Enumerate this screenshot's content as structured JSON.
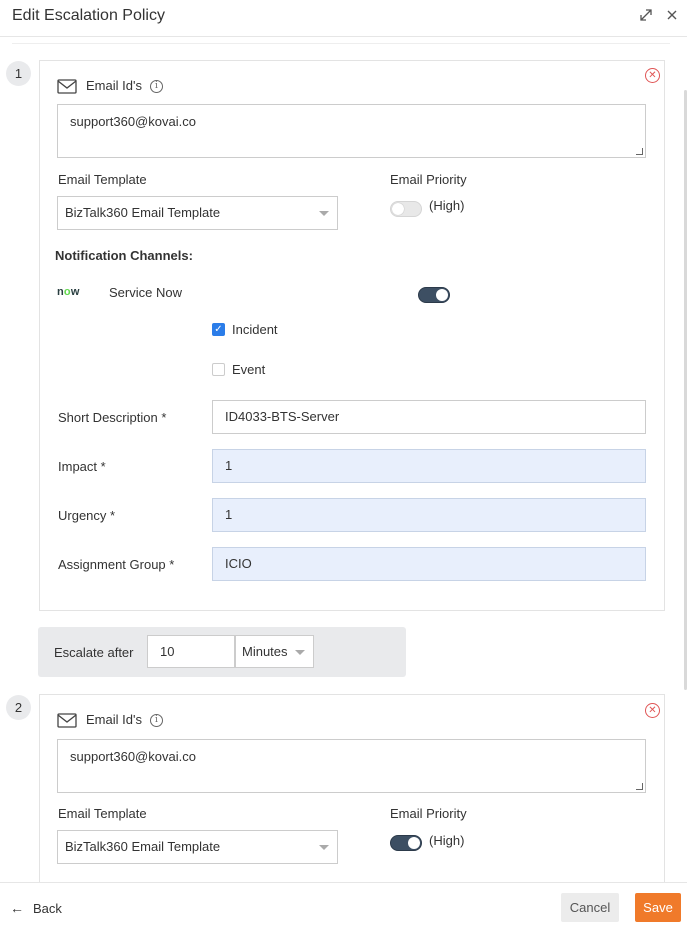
{
  "header": {
    "title": "Edit Escalation Policy",
    "expand_icon": "expand-icon",
    "close_icon": "close-icon"
  },
  "steps": [
    {
      "number": "1",
      "email_label": "Email Id's",
      "email_value": "support360@kovai.co",
      "template_label": "Email Template",
      "template_value": "BizTalk360 Email Template",
      "priority_label": "Email Priority",
      "priority_text": "(High)",
      "priority_on": false,
      "notification_label": "Notification Channels:",
      "channel": {
        "logo": "now",
        "name": "Service Now",
        "enabled": true,
        "incident_label": "Incident",
        "incident_checked": true,
        "event_label": "Event",
        "event_checked": false
      },
      "fields": {
        "short_description_label": "Short Description *",
        "short_description_value": "ID4033-BTS-Server",
        "impact_label": "Impact *",
        "impact_value": "1",
        "urgency_label": "Urgency *",
        "urgency_value": "1",
        "assignment_group_label": "Assignment Group *",
        "assignment_group_value": "ICIO"
      }
    },
    {
      "number": "2",
      "email_label": "Email Id's",
      "email_value": "support360@kovai.co",
      "template_label": "Email Template",
      "template_value": "BizTalk360 Email Template",
      "priority_label": "Email Priority",
      "priority_text": "(High)",
      "priority_on": true
    }
  ],
  "escalate": {
    "label": "Escalate after",
    "value": "10",
    "unit": "Minutes"
  },
  "footer": {
    "back_label": "Back",
    "cancel_label": "Cancel",
    "save_label": "Save"
  },
  "colors": {
    "accent": "#f07a2a",
    "toggle_on": "#3d4f63",
    "checkbox": "#2b7de9",
    "filled_input": "#e8effc",
    "remove": "#e05555"
  }
}
